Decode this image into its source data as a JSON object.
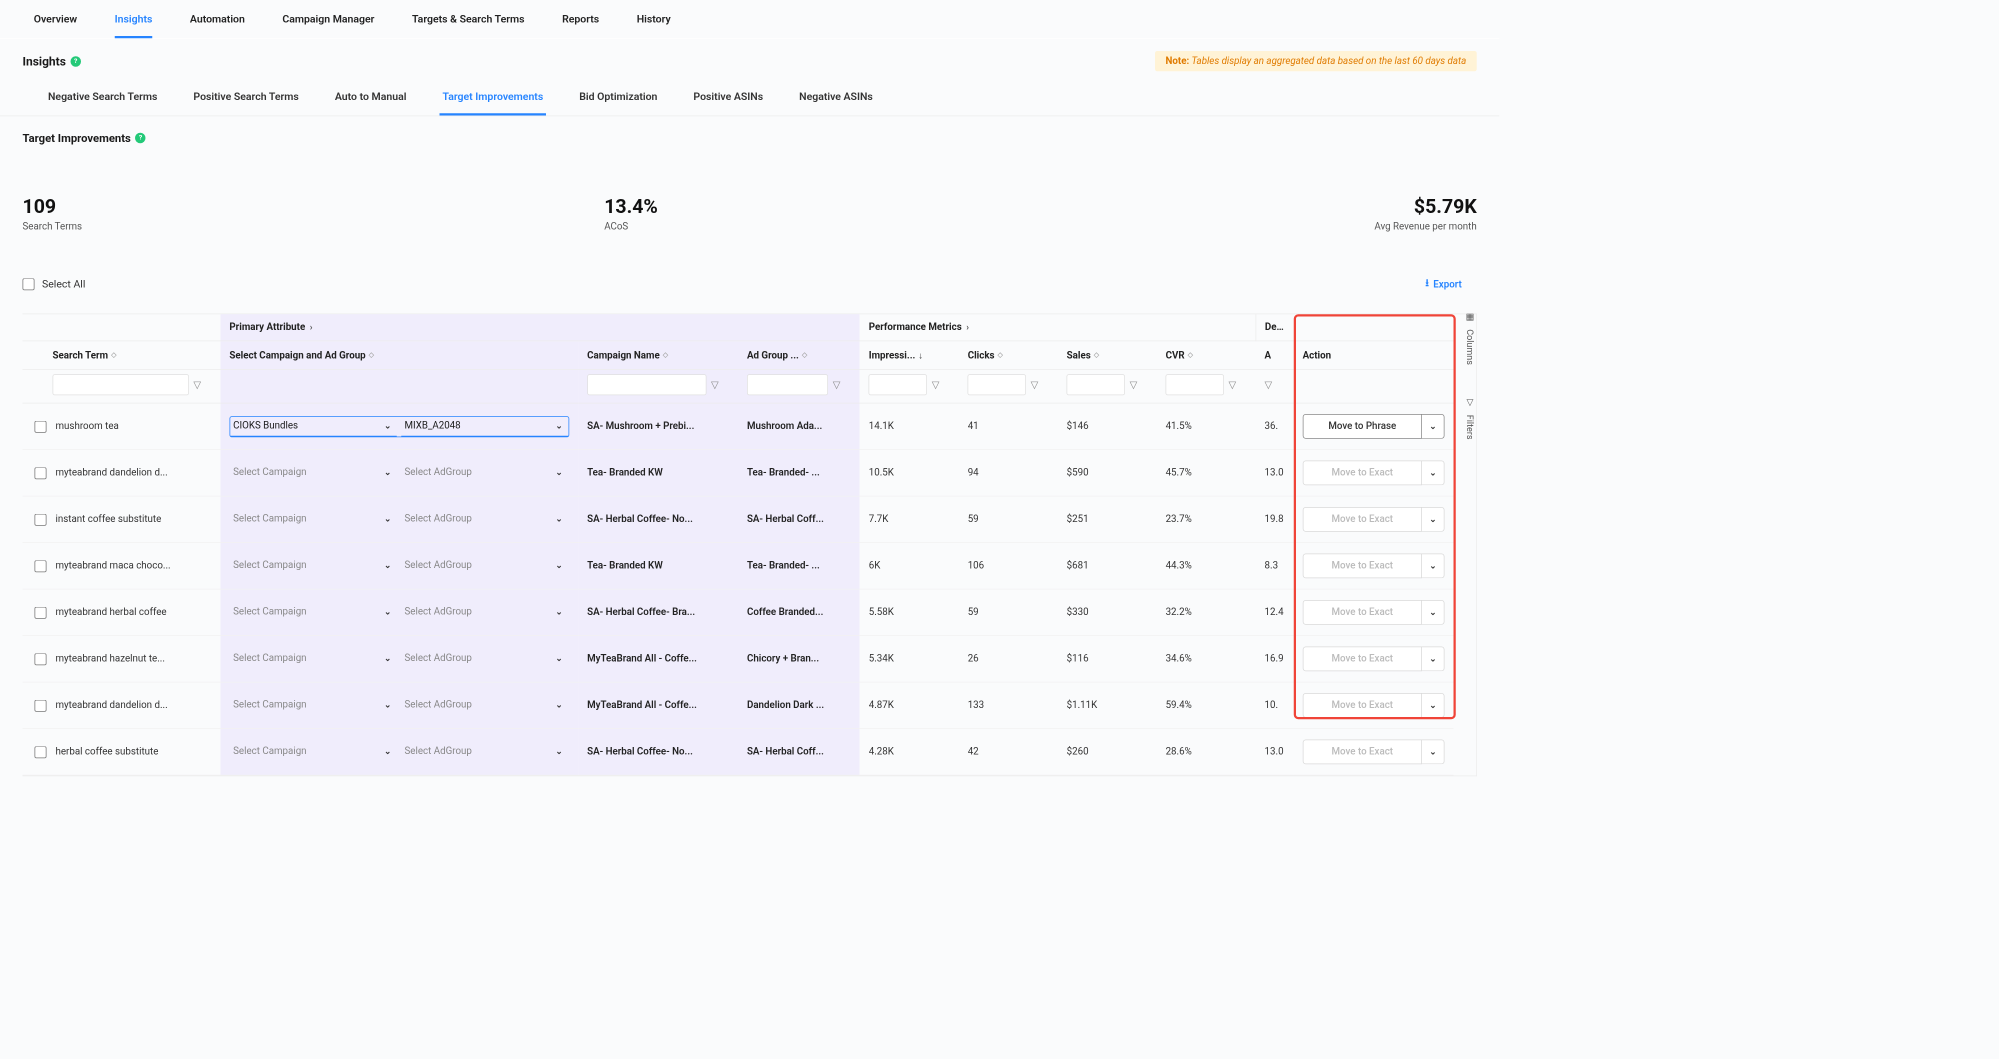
{
  "mainTabs": [
    "Overview",
    "Insights",
    "Automation",
    "Campaign Manager",
    "Targets & Search Terms",
    "Reports",
    "History"
  ],
  "mainTabActive": 1,
  "insightsTitle": "Insights",
  "note": {
    "prefix": "Note:",
    "text": "Tables display an aggregated data based on the last 60 days data"
  },
  "subTabs": [
    "Negative Search Terms",
    "Positive Search Terms",
    "Auto to Manual",
    "Target Improvements",
    "Bid Optimization",
    "Positive ASINs",
    "Negative ASINs"
  ],
  "subTabActive": 3,
  "sectionTitle": "Target Improvements",
  "stats": [
    {
      "value": "109",
      "label": "Search Terms"
    },
    {
      "value": "13.4%",
      "label": "ACoS"
    },
    {
      "value": "$5.79K",
      "label": "Avg Revenue per month"
    }
  ],
  "selectAllLabel": "Select All",
  "exportLabel": "Export",
  "sidebarButtons": [
    "Columns",
    "Filters"
  ],
  "groupHeaders": {
    "primary": "Primary Attribute",
    "performance": "Performance Metrics",
    "derived": "Derived Metrics"
  },
  "columns": {
    "searchTerm": "Search Term",
    "selectCampaign": "Select Campaign and Ad Group",
    "campaignName": "Campaign Name",
    "adGroup": "Ad Group ...",
    "impressions": "Impressi...",
    "clicks": "Clicks",
    "sales": "Sales",
    "cvr": "CVR",
    "a": "A",
    "action": "Action"
  },
  "placeholderCampaign": "Select Campaign",
  "placeholderAdGroup": "Select AdGroup",
  "rows": [
    {
      "term": "mushroom tea",
      "campaignSel": "CIOKS Bundles",
      "adgroupSel": "MIXB_A2048",
      "selected": true,
      "campaign": "SA- Mushroom + Prebi...",
      "adgroup": "Mushroom Ada...",
      "impr": "14.1K",
      "clicks": "41",
      "sales": "$146",
      "cvr": "41.5%",
      "a": "36.",
      "action": "Move to Phrase",
      "actionEnabled": true
    },
    {
      "term": "myteabrand dandelion d...",
      "campaignSel": "",
      "adgroupSel": "",
      "selected": false,
      "campaign": "Tea- Branded KW",
      "adgroup": "Tea- Branded- ...",
      "impr": "10.5K",
      "clicks": "94",
      "sales": "$590",
      "cvr": "45.7%",
      "a": "13.0",
      "action": "Move to Exact",
      "actionEnabled": false
    },
    {
      "term": "instant coffee substitute",
      "campaignSel": "",
      "adgroupSel": "",
      "selected": false,
      "campaign": "SA- Herbal Coffee- No...",
      "adgroup": "SA- Herbal Coff...",
      "impr": "7.7K",
      "clicks": "59",
      "sales": "$251",
      "cvr": "23.7%",
      "a": "19.8",
      "action": "Move to Exact",
      "actionEnabled": false
    },
    {
      "term": "myteabrand maca choco...",
      "campaignSel": "",
      "adgroupSel": "",
      "selected": false,
      "campaign": "Tea- Branded KW",
      "adgroup": "Tea- Branded- ...",
      "impr": "6K",
      "clicks": "106",
      "sales": "$681",
      "cvr": "44.3%",
      "a": "8.3",
      "action": "Move to Exact",
      "actionEnabled": false
    },
    {
      "term": "myteabrand herbal coffee",
      "campaignSel": "",
      "adgroupSel": "",
      "selected": false,
      "campaign": "SA- Herbal Coffee- Bra...",
      "adgroup": "Coffee Branded...",
      "impr": "5.58K",
      "clicks": "59",
      "sales": "$330",
      "cvr": "32.2%",
      "a": "12.4",
      "action": "Move to Exact",
      "actionEnabled": false
    },
    {
      "term": "myteabrand hazelnut te...",
      "campaignSel": "",
      "adgroupSel": "",
      "selected": false,
      "campaign": "MyTeaBrand All - Coffe...",
      "adgroup": "Chicory + Bran...",
      "impr": "5.34K",
      "clicks": "26",
      "sales": "$116",
      "cvr": "34.6%",
      "a": "16.9",
      "action": "Move to Exact",
      "actionEnabled": false
    },
    {
      "term": "myteabrand dandelion d...",
      "campaignSel": "",
      "adgroupSel": "",
      "selected": false,
      "campaign": "MyTeaBrand All - Coffe...",
      "adgroup": "Dandelion Dark ...",
      "impr": "4.87K",
      "clicks": "133",
      "sales": "$1.11K",
      "cvr": "59.4%",
      "a": "10.",
      "action": "Move to Exact",
      "actionEnabled": false
    },
    {
      "term": "herbal coffee substitute",
      "campaignSel": "",
      "adgroupSel": "",
      "selected": false,
      "campaign": "SA- Herbal Coffee- No...",
      "adgroup": "SA- Herbal Coff...",
      "impr": "4.28K",
      "clicks": "42",
      "sales": "$260",
      "cvr": "28.6%",
      "a": "13.0",
      "action": "Move to Exact",
      "actionEnabled": false
    }
  ]
}
